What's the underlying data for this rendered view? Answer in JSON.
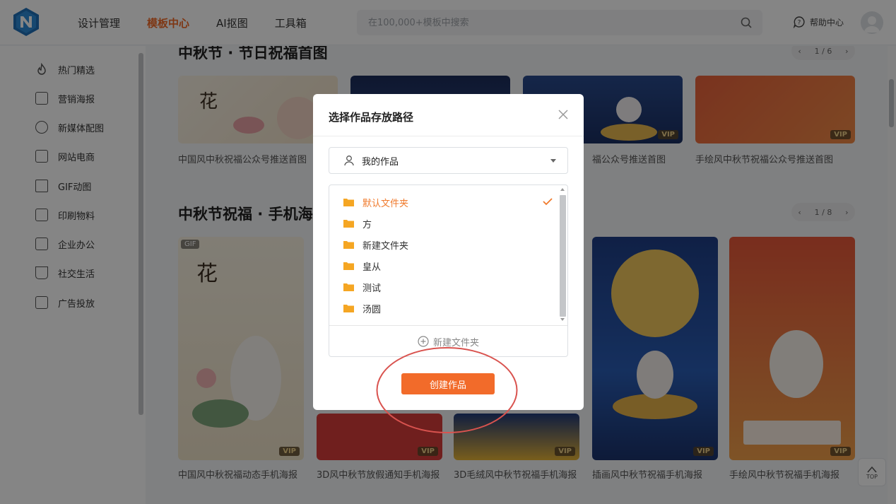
{
  "header": {
    "nav": [
      "设计管理",
      "模板中心",
      "AI抠图",
      "工具箱"
    ],
    "active_nav": "模板中心",
    "search_placeholder": "在100,000+模板中搜索",
    "help_label": "帮助中心"
  },
  "sidebar": {
    "items": [
      {
        "label": "热门精选",
        "icon": "flame-icon"
      },
      {
        "label": "营销海报",
        "icon": "poster-icon"
      },
      {
        "label": "新媒体配图",
        "icon": "chat-icon"
      },
      {
        "label": "网站电商",
        "icon": "shop-icon"
      },
      {
        "label": "GIF动图",
        "icon": "gif-icon"
      },
      {
        "label": "印刷物料",
        "icon": "print-icon"
      },
      {
        "label": "企业办公",
        "icon": "briefcase-icon"
      },
      {
        "label": "社交生活",
        "icon": "cup-icon"
      },
      {
        "label": "广告投放",
        "icon": "ad-icon"
      }
    ]
  },
  "main": {
    "section1": {
      "title": "中秋节 · 节日祝福首图",
      "pager": "1 / 6",
      "cards": [
        {
          "title": "中国风中秋祝福公众号推送首图",
          "vip": false
        },
        {
          "title": "",
          "vip": false
        },
        {
          "title": "福公众号推送首图",
          "vip": true
        },
        {
          "title": "手绘风中秋节祝福公众号推送首图",
          "vip": true
        }
      ]
    },
    "section2": {
      "title": "中秋节祝福 · 手机海",
      "pager": "1 / 8",
      "cards": [
        {
          "title": "中国风中秋祝福动态手机海报",
          "vip": true,
          "gif": "GIF"
        },
        {
          "title": "3D风中秋节放假通知手机海报",
          "vip": true
        },
        {
          "title": "3D毛绒风中秋节祝福手机海报",
          "vip": true
        },
        {
          "title": "插画风中秋节祝福手机海报",
          "vip": true
        },
        {
          "title": "手绘风中秋节祝福手机海报",
          "vip": true
        }
      ]
    },
    "vip_label": "VIP",
    "top_label": "TOP"
  },
  "modal": {
    "title": "选择作品存放路径",
    "select_value": "我的作品",
    "folders": [
      {
        "name": "默认文件夹",
        "selected": true
      },
      {
        "name": "方",
        "selected": false
      },
      {
        "name": "新建文件夹",
        "selected": false
      },
      {
        "name": "皇从",
        "selected": false
      },
      {
        "name": "测试",
        "selected": false
      },
      {
        "name": "汤圆",
        "selected": false
      }
    ],
    "new_folder_label": "新建文件夹",
    "create_label": "创建作品"
  },
  "colors": {
    "accent": "#f26b2a",
    "folder": "#f5a623",
    "annotation": "#d9534f"
  }
}
